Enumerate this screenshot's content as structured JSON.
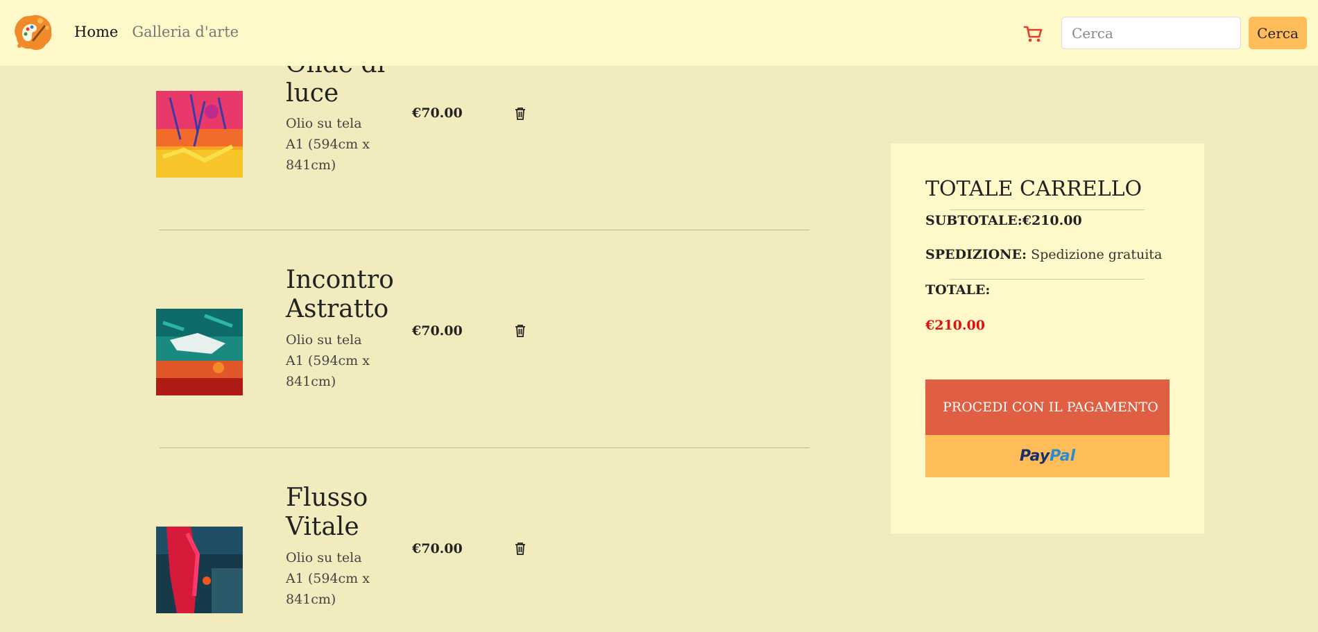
{
  "nav": {
    "home": "Home",
    "gallery": "Galleria d'arte",
    "search_placeholder": "Cerca",
    "search_button": "Cerca"
  },
  "cart": {
    "items": [
      {
        "title": "Onde di luce",
        "desc": "Olio su tela A1 (594cm x 841cm)",
        "price": "€70.00"
      },
      {
        "title": "Incontro Astratto",
        "desc": "Olio su tela A1 (594cm x 841cm)",
        "price": "€70.00"
      },
      {
        "title": "Flusso Vitale",
        "desc": "Olio su tela A1 (594cm x 841cm)",
        "price": "€70.00"
      }
    ]
  },
  "summary": {
    "title": "TOTALE CARRELLO",
    "subtotal": "SUBTOTALE:€210.00",
    "shipping_label": "SPEDIZIONE:",
    "shipping_value": "Spedizione gratuita",
    "total_label": "TOTALE:",
    "total_value": "€210.00",
    "checkout_button": "PROCEDI CON IL PAGAMENTO",
    "paypal_a": "Pay",
    "paypal_b": "Pal"
  },
  "colors": {
    "background": "#f2ebbd",
    "navbar": "#fff8c8",
    "accent": "#ffbd59",
    "checkout": "#e05f42",
    "total": "#e01010"
  }
}
